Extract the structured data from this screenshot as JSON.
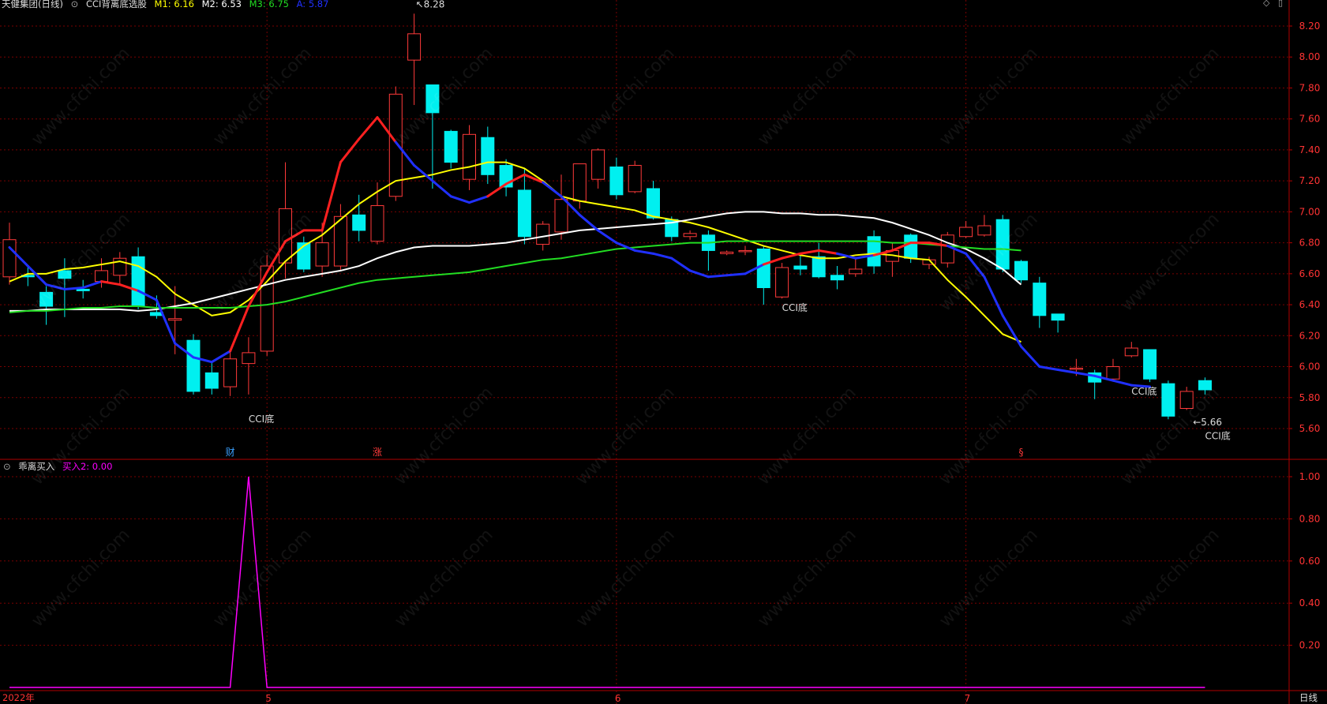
{
  "header": {
    "title": "天健集团(日线)",
    "indicator_name": "CCI背离底选股",
    "m1_label": "M1: 6.16",
    "m2_label": "M2: 6.53",
    "m3_label": "M3: 6.75",
    "a_label": "A: 5.87"
  },
  "sub_header": {
    "indicator_name": "乖离买入",
    "buy2_label": "买入2: 0.00"
  },
  "footer": {
    "year_label": "2022年",
    "period_label": "日线"
  },
  "colors": {
    "up": "#ff3a3a",
    "down": "#00f0f0",
    "m1": "#ffff00",
    "m2": "#ffffff",
    "m3": "#22dd22",
    "a_up": "#ff2020",
    "a_down": "#2030ff",
    "buy2": "#ff00ff",
    "grid": "#7a0000",
    "axis_text": "#ff3333"
  },
  "chart_data": [
    {
      "type": "candlestick",
      "title": "CCI背离底选股",
      "ylim": [
        5.5,
        8.3
      ],
      "yticks": [
        5.6,
        5.8,
        6.0,
        6.2,
        6.4,
        6.6,
        6.8,
        7.0,
        7.2,
        7.4,
        7.6,
        7.8,
        8.0,
        8.2
      ],
      "x_month_labels": [
        {
          "index": 14,
          "label": "5"
        },
        {
          "index": 33,
          "label": "6"
        },
        {
          "index": 52,
          "label": "7"
        }
      ],
      "candles": [
        [
          6.58,
          6.82,
          6.53,
          6.93
        ],
        [
          6.59,
          6.58,
          6.52,
          6.64
        ],
        [
          6.48,
          6.39,
          6.27,
          6.52
        ],
        [
          6.62,
          6.57,
          6.32,
          6.7
        ],
        [
          6.5,
          6.49,
          6.44,
          6.56
        ],
        [
          6.55,
          6.62,
          6.51,
          6.7
        ],
        [
          6.59,
          6.7,
          6.53,
          6.74
        ],
        [
          6.71,
          6.39,
          6.37,
          6.77
        ],
        [
          6.35,
          6.33,
          6.31,
          6.46
        ],
        [
          6.3,
          6.31,
          6.08,
          6.52
        ],
        [
          6.17,
          5.84,
          5.82,
          6.21
        ],
        [
          5.96,
          5.86,
          5.82,
          6.03
        ],
        [
          5.87,
          6.05,
          5.81,
          6.1
        ],
        [
          6.02,
          6.09,
          5.82,
          6.19
        ],
        [
          6.1,
          6.65,
          6.07,
          6.72
        ],
        [
          6.67,
          7.02,
          6.57,
          7.32
        ],
        [
          6.8,
          6.63,
          6.61,
          6.84
        ],
        [
          6.65,
          6.8,
          6.58,
          6.93
        ],
        [
          6.65,
          6.97,
          6.62,
          7.05
        ],
        [
          6.98,
          6.88,
          6.81,
          7.11
        ],
        [
          6.81,
          7.04,
          6.79,
          7.19
        ],
        [
          7.1,
          7.76,
          7.07,
          7.81
        ],
        [
          7.98,
          8.15,
          7.69,
          8.28
        ],
        [
          7.82,
          7.64,
          7.15,
          7.82
        ],
        [
          7.52,
          7.32,
          7.28,
          7.53
        ],
        [
          7.21,
          7.5,
          7.14,
          7.56
        ],
        [
          7.48,
          7.24,
          7.18,
          7.55
        ],
        [
          7.3,
          7.16,
          7.1,
          7.34
        ],
        [
          7.14,
          6.84,
          6.79,
          7.28
        ],
        [
          6.79,
          6.92,
          6.75,
          6.94
        ],
        [
          6.87,
          7.08,
          6.82,
          7.24
        ],
        [
          7.07,
          7.31,
          7.02,
          7.31
        ],
        [
          7.21,
          7.4,
          7.15,
          7.41
        ],
        [
          7.29,
          7.11,
          7.08,
          7.35
        ],
        [
          7.13,
          7.3,
          7.12,
          7.33
        ],
        [
          7.15,
          6.96,
          6.95,
          7.2
        ],
        [
          6.95,
          6.84,
          6.81,
          6.97
        ],
        [
          6.84,
          6.86,
          6.82,
          6.88
        ],
        [
          6.85,
          6.75,
          6.62,
          6.88
        ],
        [
          6.73,
          6.74,
          6.72,
          6.75
        ],
        [
          6.75,
          6.75,
          6.72,
          6.78
        ],
        [
          6.76,
          6.51,
          6.4,
          6.78
        ],
        [
          6.45,
          6.64,
          6.44,
          6.67
        ],
        [
          6.65,
          6.63,
          6.59,
          6.72
        ],
        [
          6.71,
          6.58,
          6.57,
          6.8
        ],
        [
          6.59,
          6.56,
          6.5,
          6.65
        ],
        [
          6.6,
          6.63,
          6.58,
          6.7
        ],
        [
          6.84,
          6.65,
          6.6,
          6.88
        ],
        [
          6.68,
          6.75,
          6.58,
          6.8
        ],
        [
          6.85,
          6.7,
          6.67,
          6.86
        ],
        [
          6.66,
          6.69,
          6.63,
          6.71
        ],
        [
          6.67,
          6.85,
          6.64,
          6.87
        ],
        [
          6.84,
          6.9,
          6.83,
          6.94
        ],
        [
          6.85,
          6.91,
          6.84,
          6.98
        ],
        [
          6.95,
          6.63,
          6.61,
          6.98
        ],
        [
          6.68,
          6.56,
          6.54,
          6.69
        ],
        [
          6.54,
          6.33,
          6.25,
          6.58
        ],
        [
          6.34,
          6.3,
          6.22,
          6.34
        ],
        [
          5.99,
          5.99,
          5.94,
          6.05
        ],
        [
          5.96,
          5.9,
          5.79,
          5.98
        ],
        [
          5.92,
          6.0,
          5.91,
          6.05
        ],
        [
          6.07,
          6.12,
          6.06,
          6.16
        ],
        [
          6.11,
          5.92,
          5.9,
          6.11
        ],
        [
          5.89,
          5.68,
          5.66,
          5.91
        ],
        [
          5.73,
          5.84,
          5.72,
          5.87
        ],
        [
          5.91,
          5.85,
          5.82,
          5.93
        ]
      ],
      "series": [
        {
          "name": "M1",
          "values": [
            6.55,
            6.6,
            6.6,
            6.63,
            6.64,
            6.66,
            6.68,
            6.65,
            6.58,
            6.47,
            6.4,
            6.33,
            6.35,
            6.43,
            6.55,
            6.68,
            6.78,
            6.85,
            6.95,
            7.05,
            7.13,
            7.2,
            7.22,
            7.24,
            7.27,
            7.29,
            7.32,
            7.32,
            7.28,
            7.2,
            7.1,
            7.07,
            7.05,
            7.03,
            7.01,
            6.97,
            6.95,
            6.93,
            6.9,
            6.86,
            6.82,
            6.78,
            6.75,
            6.72,
            6.7,
            6.7,
            6.72,
            6.73,
            6.72,
            6.7,
            6.69,
            6.56,
            6.45,
            6.33,
            6.21,
            6.16
          ]
        },
        {
          "name": "M2",
          "values": [
            6.36,
            6.36,
            6.37,
            6.37,
            6.37,
            6.37,
            6.37,
            6.36,
            6.37,
            6.39,
            6.41,
            6.44,
            6.47,
            6.5,
            6.53,
            6.56,
            6.58,
            6.6,
            6.62,
            6.65,
            6.7,
            6.74,
            6.77,
            6.78,
            6.78,
            6.78,
            6.79,
            6.8,
            6.82,
            6.84,
            6.86,
            6.88,
            6.89,
            6.9,
            6.91,
            6.92,
            6.93,
            6.95,
            6.97,
            6.99,
            7.0,
            7.0,
            6.99,
            6.99,
            6.98,
            6.98,
            6.97,
            6.96,
            6.93,
            6.89,
            6.85,
            6.8,
            6.76,
            6.7,
            6.63,
            6.53
          ]
        },
        {
          "name": "M3",
          "values": [
            6.35,
            6.36,
            6.36,
            6.37,
            6.38,
            6.38,
            6.39,
            6.39,
            6.38,
            6.38,
            6.38,
            6.38,
            6.38,
            6.39,
            6.4,
            6.42,
            6.45,
            6.48,
            6.51,
            6.54,
            6.56,
            6.57,
            6.58,
            6.59,
            6.6,
            6.61,
            6.63,
            6.65,
            6.67,
            6.69,
            6.7,
            6.72,
            6.74,
            6.76,
            6.77,
            6.78,
            6.79,
            6.8,
            6.8,
            6.81,
            6.81,
            6.81,
            6.81,
            6.81,
            6.81,
            6.81,
            6.81,
            6.81,
            6.8,
            6.8,
            6.79,
            6.78,
            6.77,
            6.76,
            6.76,
            6.75
          ]
        },
        {
          "name": "A",
          "values": [
            6.77,
            6.65,
            6.53,
            6.5,
            6.51,
            6.55,
            6.53,
            6.49,
            6.43,
            6.15,
            6.06,
            6.03,
            6.1,
            6.39,
            6.61,
            6.81,
            6.88,
            6.88,
            7.32,
            7.47,
            7.61,
            7.45,
            7.3,
            7.2,
            7.1,
            7.06,
            7.1,
            7.18,
            7.24,
            7.19,
            7.1,
            6.98,
            6.88,
            6.8,
            6.75,
            6.73,
            6.7,
            6.62,
            6.58,
            6.59,
            6.6,
            6.66,
            6.7,
            6.73,
            6.75,
            6.73,
            6.7,
            6.72,
            6.75,
            6.8,
            6.8,
            6.78,
            6.73,
            6.58,
            6.33,
            6.13,
            6.0,
            5.98,
            5.96,
            5.94,
            5.91,
            5.88,
            5.87
          ]
        },
        {
          "name": "A_up_mask",
          "values": [
            0,
            0,
            0,
            0,
            0,
            1,
            1,
            0,
            0,
            0,
            0,
            0,
            1,
            1,
            1,
            1,
            1,
            1,
            1,
            1,
            1,
            0,
            0,
            0,
            0,
            0,
            1,
            1,
            1,
            0,
            0,
            0,
            0,
            0,
            0,
            0,
            0,
            0,
            0,
            0,
            0,
            1,
            1,
            1,
            1,
            0,
            0,
            1,
            1,
            1,
            1,
            0,
            0,
            0,
            0,
            0,
            0,
            0,
            0,
            0,
            0,
            0,
            0
          ]
        }
      ],
      "annotations": [
        {
          "index": 22,
          "price": 8.28,
          "text": "8.28",
          "kind": "high"
        },
        {
          "index": 64,
          "price": 5.66,
          "text": "5.66",
          "kind": "low"
        },
        {
          "index": 13,
          "price": 5.64,
          "text": "CCI底"
        },
        {
          "index": 42,
          "price": 6.36,
          "text": "CCI底"
        },
        {
          "index": 61,
          "price": 5.82,
          "text": "CCI底"
        },
        {
          "index": 65,
          "price": 5.53,
          "text": "CCI底"
        }
      ],
      "markers": [
        {
          "index": 12,
          "text": "财",
          "color": "#3aa0ff"
        },
        {
          "index": 20,
          "text": "涨",
          "color": "#ff3a3a"
        },
        {
          "index": 55,
          "text": "§",
          "color": "#ff3a3a"
        }
      ]
    },
    {
      "type": "line",
      "title": "乖离买入",
      "ylim": [
        0,
        1.05
      ],
      "yticks": [
        0.2,
        0.4,
        0.6,
        0.8,
        1.0
      ],
      "series": [
        {
          "name": "买入2",
          "values": [
            0,
            0,
            0,
            0,
            0,
            0,
            0,
            0,
            0,
            0,
            0,
            0,
            0,
            1,
            0,
            0,
            0,
            0,
            0,
            0,
            0,
            0,
            0,
            0,
            0,
            0,
            0,
            0,
            0,
            0,
            0,
            0,
            0,
            0,
            0,
            0,
            0,
            0,
            0,
            0,
            0,
            0,
            0,
            0,
            0,
            0,
            0,
            0,
            0,
            0,
            0,
            0,
            0,
            0,
            0,
            0,
            0,
            0,
            0,
            0,
            0,
            0,
            0,
            0,
            0,
            0
          ]
        }
      ]
    }
  ]
}
